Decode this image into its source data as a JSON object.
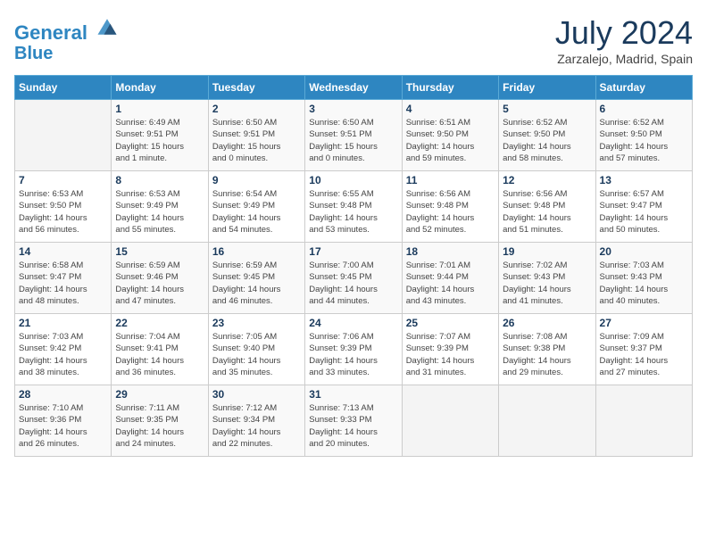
{
  "header": {
    "logo_line1": "General",
    "logo_line2": "Blue",
    "month": "July 2024",
    "location": "Zarzalejo, Madrid, Spain"
  },
  "columns": [
    "Sunday",
    "Monday",
    "Tuesday",
    "Wednesday",
    "Thursday",
    "Friday",
    "Saturday"
  ],
  "weeks": [
    [
      {
        "day": "",
        "info": ""
      },
      {
        "day": "1",
        "info": "Sunrise: 6:49 AM\nSunset: 9:51 PM\nDaylight: 15 hours\nand 1 minute."
      },
      {
        "day": "2",
        "info": "Sunrise: 6:50 AM\nSunset: 9:51 PM\nDaylight: 15 hours\nand 0 minutes."
      },
      {
        "day": "3",
        "info": "Sunrise: 6:50 AM\nSunset: 9:51 PM\nDaylight: 15 hours\nand 0 minutes."
      },
      {
        "day": "4",
        "info": "Sunrise: 6:51 AM\nSunset: 9:50 PM\nDaylight: 14 hours\nand 59 minutes."
      },
      {
        "day": "5",
        "info": "Sunrise: 6:52 AM\nSunset: 9:50 PM\nDaylight: 14 hours\nand 58 minutes."
      },
      {
        "day": "6",
        "info": "Sunrise: 6:52 AM\nSunset: 9:50 PM\nDaylight: 14 hours\nand 57 minutes."
      }
    ],
    [
      {
        "day": "7",
        "info": "Sunrise: 6:53 AM\nSunset: 9:50 PM\nDaylight: 14 hours\nand 56 minutes."
      },
      {
        "day": "8",
        "info": "Sunrise: 6:53 AM\nSunset: 9:49 PM\nDaylight: 14 hours\nand 55 minutes."
      },
      {
        "day": "9",
        "info": "Sunrise: 6:54 AM\nSunset: 9:49 PM\nDaylight: 14 hours\nand 54 minutes."
      },
      {
        "day": "10",
        "info": "Sunrise: 6:55 AM\nSunset: 9:48 PM\nDaylight: 14 hours\nand 53 minutes."
      },
      {
        "day": "11",
        "info": "Sunrise: 6:56 AM\nSunset: 9:48 PM\nDaylight: 14 hours\nand 52 minutes."
      },
      {
        "day": "12",
        "info": "Sunrise: 6:56 AM\nSunset: 9:48 PM\nDaylight: 14 hours\nand 51 minutes."
      },
      {
        "day": "13",
        "info": "Sunrise: 6:57 AM\nSunset: 9:47 PM\nDaylight: 14 hours\nand 50 minutes."
      }
    ],
    [
      {
        "day": "14",
        "info": "Sunrise: 6:58 AM\nSunset: 9:47 PM\nDaylight: 14 hours\nand 48 minutes."
      },
      {
        "day": "15",
        "info": "Sunrise: 6:59 AM\nSunset: 9:46 PM\nDaylight: 14 hours\nand 47 minutes."
      },
      {
        "day": "16",
        "info": "Sunrise: 6:59 AM\nSunset: 9:45 PM\nDaylight: 14 hours\nand 46 minutes."
      },
      {
        "day": "17",
        "info": "Sunrise: 7:00 AM\nSunset: 9:45 PM\nDaylight: 14 hours\nand 44 minutes."
      },
      {
        "day": "18",
        "info": "Sunrise: 7:01 AM\nSunset: 9:44 PM\nDaylight: 14 hours\nand 43 minutes."
      },
      {
        "day": "19",
        "info": "Sunrise: 7:02 AM\nSunset: 9:43 PM\nDaylight: 14 hours\nand 41 minutes."
      },
      {
        "day": "20",
        "info": "Sunrise: 7:03 AM\nSunset: 9:43 PM\nDaylight: 14 hours\nand 40 minutes."
      }
    ],
    [
      {
        "day": "21",
        "info": "Sunrise: 7:03 AM\nSunset: 9:42 PM\nDaylight: 14 hours\nand 38 minutes."
      },
      {
        "day": "22",
        "info": "Sunrise: 7:04 AM\nSunset: 9:41 PM\nDaylight: 14 hours\nand 36 minutes."
      },
      {
        "day": "23",
        "info": "Sunrise: 7:05 AM\nSunset: 9:40 PM\nDaylight: 14 hours\nand 35 minutes."
      },
      {
        "day": "24",
        "info": "Sunrise: 7:06 AM\nSunset: 9:39 PM\nDaylight: 14 hours\nand 33 minutes."
      },
      {
        "day": "25",
        "info": "Sunrise: 7:07 AM\nSunset: 9:39 PM\nDaylight: 14 hours\nand 31 minutes."
      },
      {
        "day": "26",
        "info": "Sunrise: 7:08 AM\nSunset: 9:38 PM\nDaylight: 14 hours\nand 29 minutes."
      },
      {
        "day": "27",
        "info": "Sunrise: 7:09 AM\nSunset: 9:37 PM\nDaylight: 14 hours\nand 27 minutes."
      }
    ],
    [
      {
        "day": "28",
        "info": "Sunrise: 7:10 AM\nSunset: 9:36 PM\nDaylight: 14 hours\nand 26 minutes."
      },
      {
        "day": "29",
        "info": "Sunrise: 7:11 AM\nSunset: 9:35 PM\nDaylight: 14 hours\nand 24 minutes."
      },
      {
        "day": "30",
        "info": "Sunrise: 7:12 AM\nSunset: 9:34 PM\nDaylight: 14 hours\nand 22 minutes."
      },
      {
        "day": "31",
        "info": "Sunrise: 7:13 AM\nSunset: 9:33 PM\nDaylight: 14 hours\nand 20 minutes."
      },
      {
        "day": "",
        "info": ""
      },
      {
        "day": "",
        "info": ""
      },
      {
        "day": "",
        "info": ""
      }
    ]
  ]
}
